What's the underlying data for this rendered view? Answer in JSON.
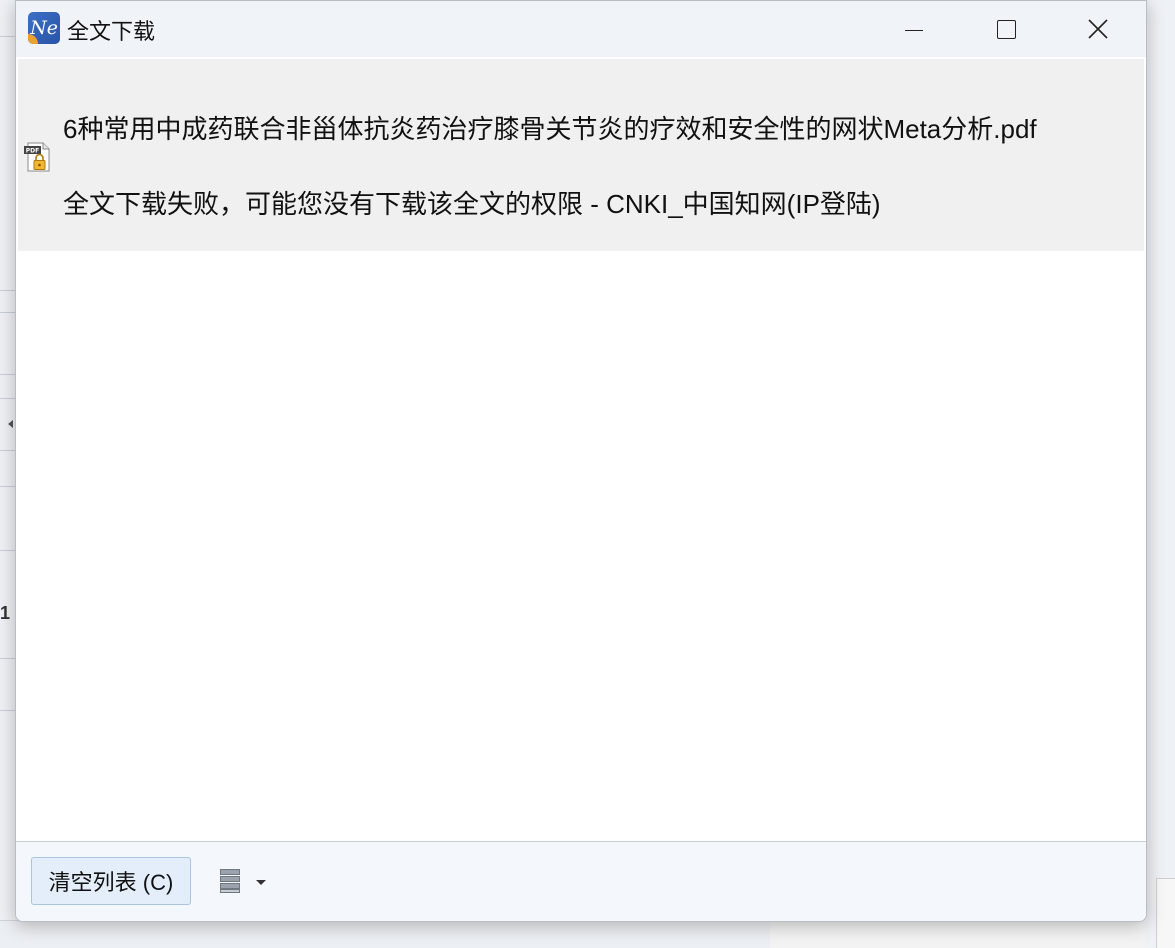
{
  "window": {
    "title": "全文下载",
    "app_icon_text": "Ne"
  },
  "download_item": {
    "filename": "6种常用中成药联合非甾体抗炎药治疗膝骨关节炎的疗效和安全性的网状Meta分析.pdf",
    "status": "全文下载失败，可能您没有下载该全文的权限 - CNKI_中国知网(IP登陆)",
    "icon": "pdf-locked-icon",
    "icon_badge": "PDF"
  },
  "footer": {
    "clear_label": "清空列表 (C)",
    "server_icon": "server-icon"
  },
  "background": {
    "partial_char": "1"
  },
  "colors": {
    "titlebar_bg": "#f0f4f9",
    "item_bg": "#f0f0f0",
    "footer_bg": "#f4f8fc",
    "button_bg": "#e3eefa"
  }
}
